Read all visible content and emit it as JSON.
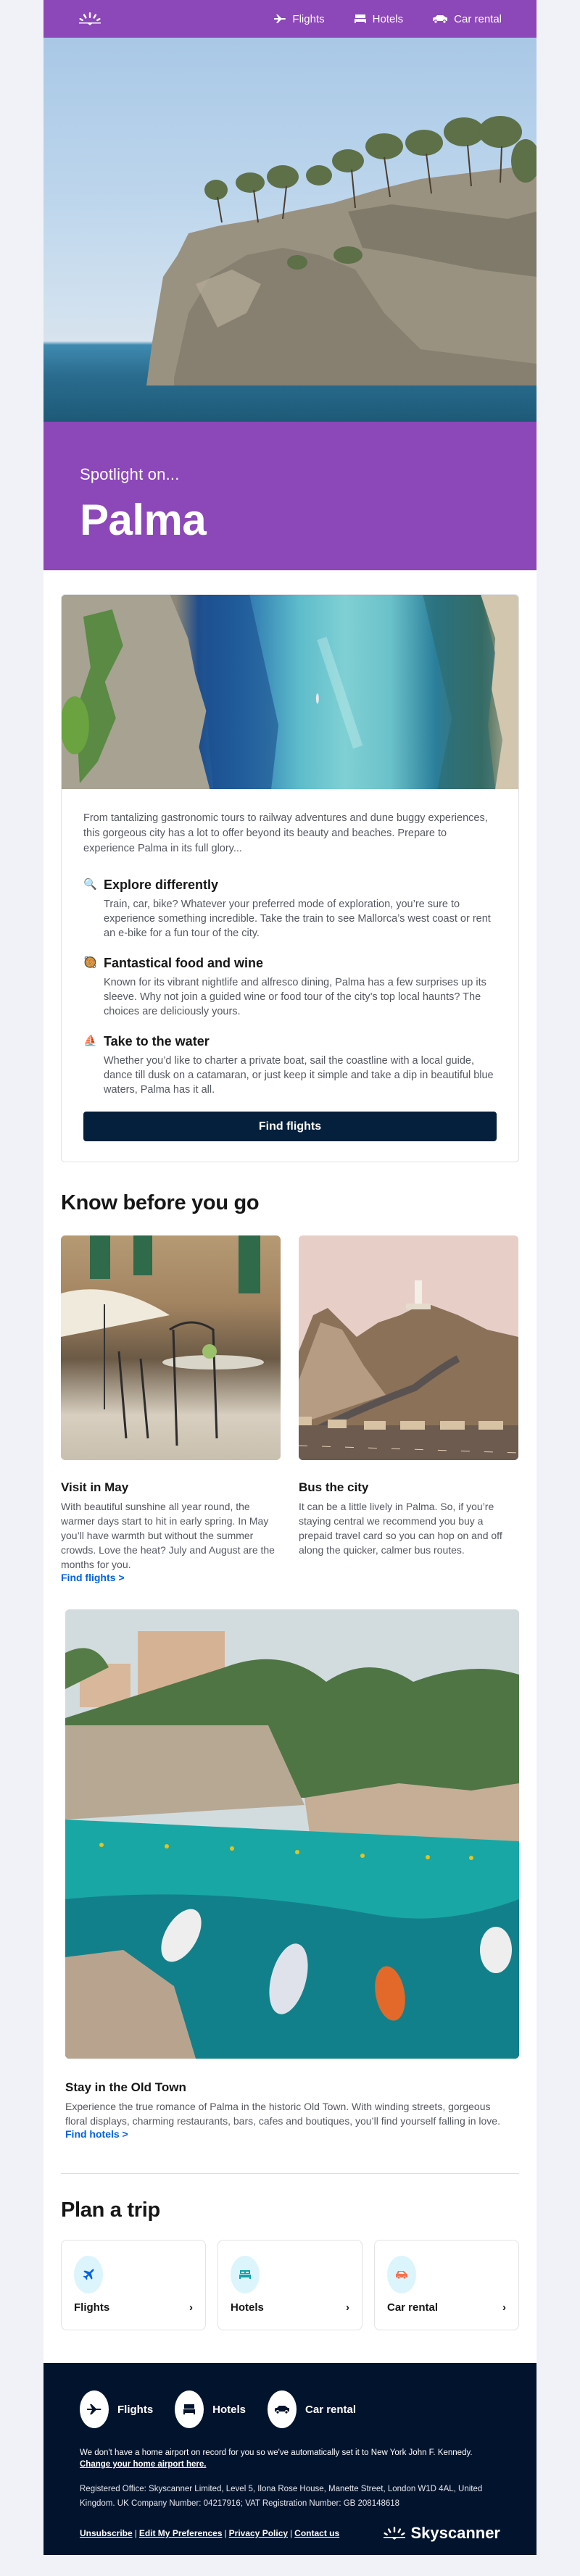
{
  "header": {
    "logo": "skyscanner-sunrise-logo",
    "nav": [
      {
        "label": "Flights",
        "icon": "plane-icon"
      },
      {
        "label": "Hotels",
        "icon": "bed-icon"
      },
      {
        "label": "Car rental",
        "icon": "car-icon"
      }
    ]
  },
  "hero": {
    "image_alt": "Rocky cliff with pine trees above the sea",
    "kicker": "Spotlight on...",
    "title": "Palma"
  },
  "intro_card": {
    "image_alt": "Aerial view of turquoise cove between rocky cliffs",
    "intro": "From tantalizing gastronomic tours to railway adventures and dune buggy experiences, this gorgeous city has a lot to offer beyond its beauty and beaches. Prepare to experience Palma in its full glory...",
    "features": [
      {
        "emoji": "🔍",
        "icon": "magnifying-glass-icon",
        "title": "Explore differently",
        "text": "Train, car, bike? Whatever your preferred mode of exploration, you’re sure to experience something incredible. Take the train to see Mallorca’s west coast or rent an e-bike for a fun tour of the city."
      },
      {
        "emoji": "🥘",
        "icon": "paella-icon",
        "title": "Fantastical food and wine",
        "text": "Known for its vibrant nightlife and alfresco dining, Palma has a few surprises up its sleeve. Why not join a guided wine or food tour of the city’s top local haunts? The choices are deliciously yours."
      },
      {
        "emoji": "⛵",
        "icon": "sailboat-icon",
        "title": "Take to the water",
        "text": "Whether you’d like to charter a private boat, sail the coastline with a local guide, dance till dusk on a catamaran, or just keep it simple and take a dip in beautiful blue waters, Palma has it all."
      }
    ],
    "cta": "Find flights"
  },
  "know_before": {
    "heading": "Know before you go",
    "items": [
      {
        "image_alt": "Cafe terrace with umbrella and iron chairs",
        "title": "Visit in May",
        "text": "With beautiful sunshine all year round, the warmer days start to hit in early spring. In May you’ll have warmth but without the summer crowds. Love the heat? July and August are the months for you.",
        "link": "Find flights >"
      },
      {
        "image_alt": "Winding road to lighthouse on a cliff",
        "title": "Bus the city",
        "text": "It can be a little lively in Palma. So, if you’re staying central we recommend you buy a prepaid travel card so you can hop on and off along the quicker, calmer bus routes.",
        "link": ""
      }
    ]
  },
  "old_town": {
    "image_alt": "Boats moored in a turquoise cove below villas",
    "title": "Stay in the Old Town",
    "text": "Experience the true romance of Palma in the historic Old Town. With winding streets, gorgeous floral displays, charming restaurants, bars, cafes and boutiques, you’ll find yourself falling in love.",
    "link": "Find hotels >"
  },
  "plan": {
    "heading": "Plan a trip",
    "cards": [
      {
        "label": "Flights",
        "icon": "plane-icon",
        "color": "#0062e3",
        "chevron": "›"
      },
      {
        "label": "Hotels",
        "icon": "bed-icon",
        "color": "#0fa1a9",
        "chevron": "›"
      },
      {
        "label": "Car rental",
        "icon": "car-icon",
        "color": "#f5714f",
        "chevron": "›"
      }
    ]
  },
  "footer": {
    "nav": [
      {
        "label": "Flights",
        "icon": "plane-icon"
      },
      {
        "label": "Hotels",
        "icon": "bed-icon"
      },
      {
        "label": "Car rental",
        "icon": "car-icon"
      }
    ],
    "airport_note": "We don't have a home airport on record for you so we've automatically set it to New York John F. Kennedy.",
    "airport_link": "Change your home airport here.",
    "registered": "Registered Office: Skyscanner Limited, Level 5, Ilona Rose House, Manette Street, London W1D 4AL, United Kingdom. UK Company Number: 04217916; VAT Registration Number: GB 208148618",
    "links": [
      "Unsubscribe",
      "Edit My Preferences",
      "Privacy Policy",
      "Contact us"
    ],
    "separator": "|",
    "brand": "Skyscanner"
  },
  "colors": {
    "brand_purple": "#8c47b9",
    "navy": "#05203c",
    "footer_bg": "#02132d",
    "link_blue": "#0062e3",
    "page_bg": "#f1f2f8"
  }
}
